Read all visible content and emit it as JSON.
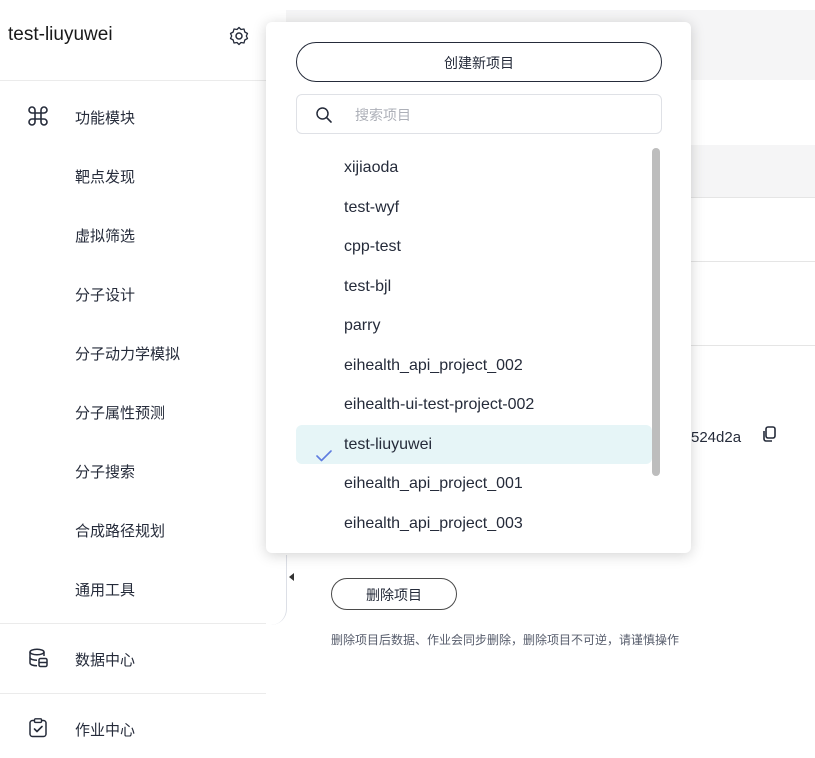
{
  "sidebar": {
    "project_name": "test-liuyuwei",
    "groups": {
      "modules": "功能模块",
      "data_center": "数据中心",
      "job_center": "作业中心"
    },
    "items": [
      "靶点发现",
      "虚拟筛选",
      "分子设计",
      "分子动力学模拟",
      "分子属性预测",
      "分子搜索",
      "合成路径规划",
      "通用工具"
    ]
  },
  "main": {
    "project_id_fragment": "524d2a",
    "delete_button": "删除项目",
    "delete_hint": "删除项目后数据、作业会同步删除，删除项目不可逆，请谨慎操作"
  },
  "dropdown": {
    "create_button": "创建新项目",
    "search_placeholder": "搜索项目",
    "projects": [
      "xijiaoda",
      "test-wyf",
      "cpp-test",
      "test-bjl",
      "parry",
      "eihealth_api_project_002",
      "eihealth-ui-test-project-002",
      "test-liuyuwei",
      "eihealth_api_project_001",
      "eihealth_api_project_003"
    ],
    "selected": "test-liuyuwei"
  },
  "colors": {
    "accent": "#5e7ce0",
    "selected_bg": "#e6f5f7",
    "text": "#252b3a"
  }
}
